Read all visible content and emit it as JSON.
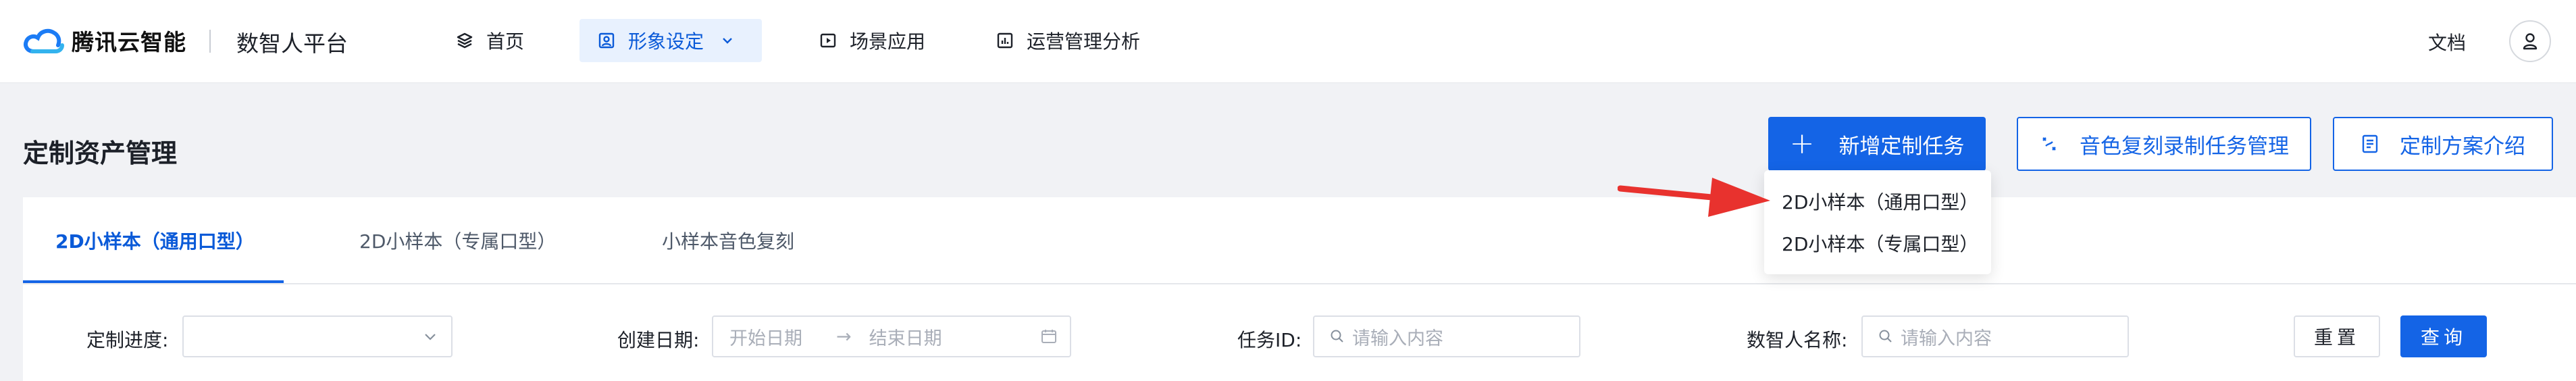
{
  "header": {
    "brand": "腾讯云智能",
    "platform": "数智人平台",
    "nav": [
      {
        "label": "首页",
        "icon": "layers-icon"
      },
      {
        "label": "形象设定",
        "icon": "portrait-icon",
        "active": true
      },
      {
        "label": "场景应用",
        "icon": "play-icon"
      },
      {
        "label": "运营管理分析",
        "icon": "chart-icon"
      }
    ],
    "docs": "文档"
  },
  "page": {
    "title": "定制资产管理",
    "primary_button": "新增定制任务",
    "voice_task_button": "音色复刻录制任务管理",
    "plan_intro_button": "定制方案介绍"
  },
  "dropdown": {
    "items": [
      "2D小样本（通用口型）",
      "2D小样本（专属口型）"
    ]
  },
  "tabs": [
    {
      "label": "2D小样本（通用口型）",
      "active": true
    },
    {
      "label": "2D小样本（专属口型）",
      "active": false
    },
    {
      "label": "小样本音色复刻",
      "active": false
    }
  ],
  "filters": {
    "progress_label": "定制进度:",
    "progress_value": "",
    "date_label": "创建日期:",
    "start_placeholder": "开始日期",
    "end_placeholder": "结束日期",
    "task_id_label": "任务ID:",
    "task_id_placeholder": "请输入内容",
    "name_label": "数智人名称:",
    "name_placeholder": "请输入内容",
    "reset": "重置",
    "query": "查询"
  },
  "colors": {
    "accent": "#1464e6",
    "annotation": "#e8322e"
  }
}
